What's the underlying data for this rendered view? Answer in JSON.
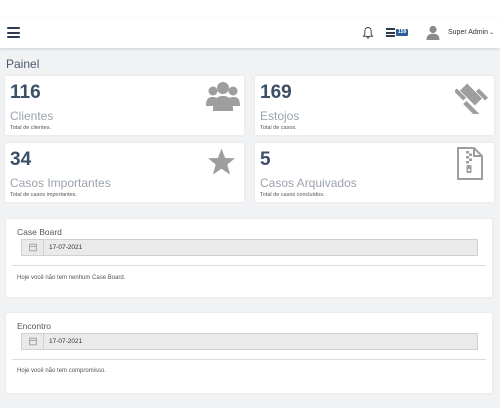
{
  "header": {
    "tasks_badge": "159",
    "user_name": "Super Admin",
    "user_caret": "⌄"
  },
  "page": {
    "title": "Painel"
  },
  "stats": [
    {
      "value": "116",
      "label": "Clientes",
      "sub": "Total de clientes.",
      "icon": "users-icon"
    },
    {
      "value": "169",
      "label": "Estojos",
      "sub": "Total de casos.",
      "icon": "gavel-icon"
    },
    {
      "value": "34",
      "label": "Casos Importantes",
      "sub": "Total de casos importantes.",
      "icon": "star-icon"
    },
    {
      "value": "5",
      "label": "Casos Arquivados",
      "sub": "Total de casos concluídos.",
      "icon": "archive-file-icon"
    }
  ],
  "case_board": {
    "title": "Case Board",
    "date": "17-07-2021",
    "empty_message": "Hoje você não tem nenhum Case Board."
  },
  "appointments": {
    "title": "Encontro",
    "date": "17-07-2021",
    "empty_message": "Hoje você não tem compromisso."
  },
  "colors": {
    "accent": "#2a5f99",
    "stat_number": "#3d4f66",
    "icon_gray": "#9e9e9e"
  }
}
